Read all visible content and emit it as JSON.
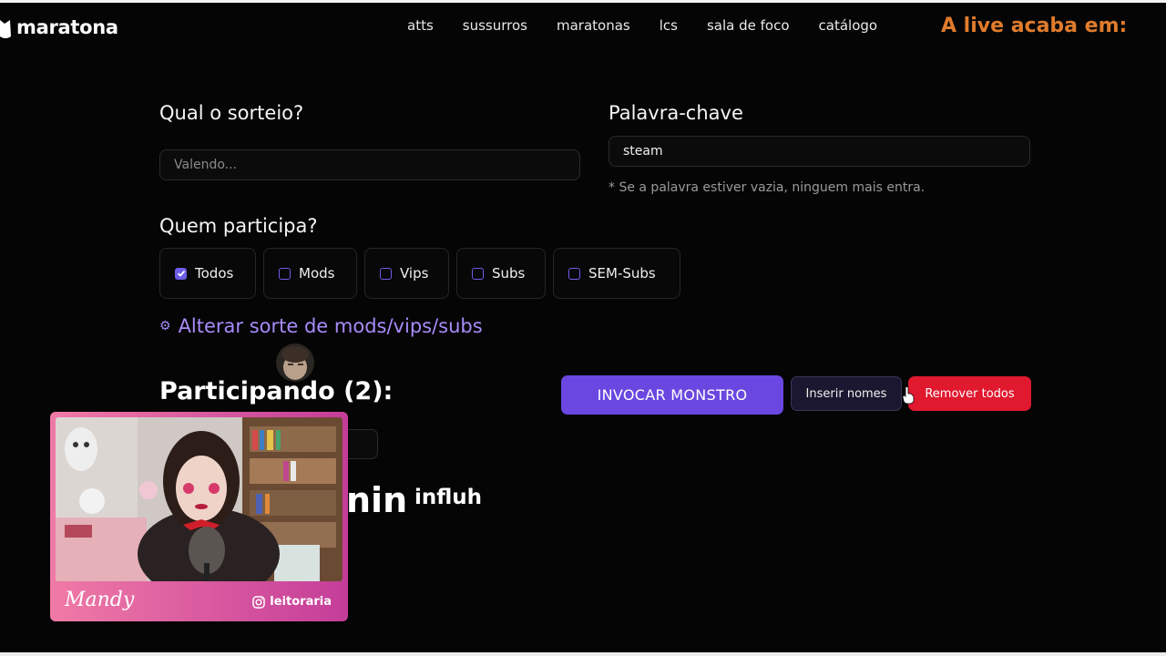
{
  "header": {
    "logo_text": "maratona",
    "nav": [
      "atts",
      "sussurros",
      "maratonas",
      "lcs",
      "sala de foco",
      "catálogo"
    ],
    "countdown_label": "A live acaba em:",
    "accent_color": "#e07b2c"
  },
  "form": {
    "raffle_label": "Qual o sorteio?",
    "raffle_placeholder": "Valendo...",
    "keyword_label": "Palavra-chave",
    "keyword_value": "steam",
    "keyword_hint": "* Se a palavra estiver vazia, ninguem mais entra.",
    "who_label": "Quem participa?",
    "options": [
      {
        "label": "Todos",
        "checked": true
      },
      {
        "label": "Mods",
        "checked": false
      },
      {
        "label": "Vips",
        "checked": false
      },
      {
        "label": "Subs",
        "checked": false
      },
      {
        "label": "SEM-Subs",
        "checked": false
      }
    ],
    "luck_icon": "gear-icon",
    "luck_link": "Alterar sorte de mods/vips/subs"
  },
  "participants": {
    "title": "Participando (2):",
    "names": [
      "…nin",
      "influh"
    ]
  },
  "actions": {
    "invoke": "INVOCAR MONSTRO",
    "insert": "Inserir nomes",
    "remove": "Remover todos",
    "primary_color": "#6a47e0",
    "danger_color": "#e0192f"
  },
  "webcam": {
    "signature": "Mandy",
    "instagram": "leitoraria"
  }
}
